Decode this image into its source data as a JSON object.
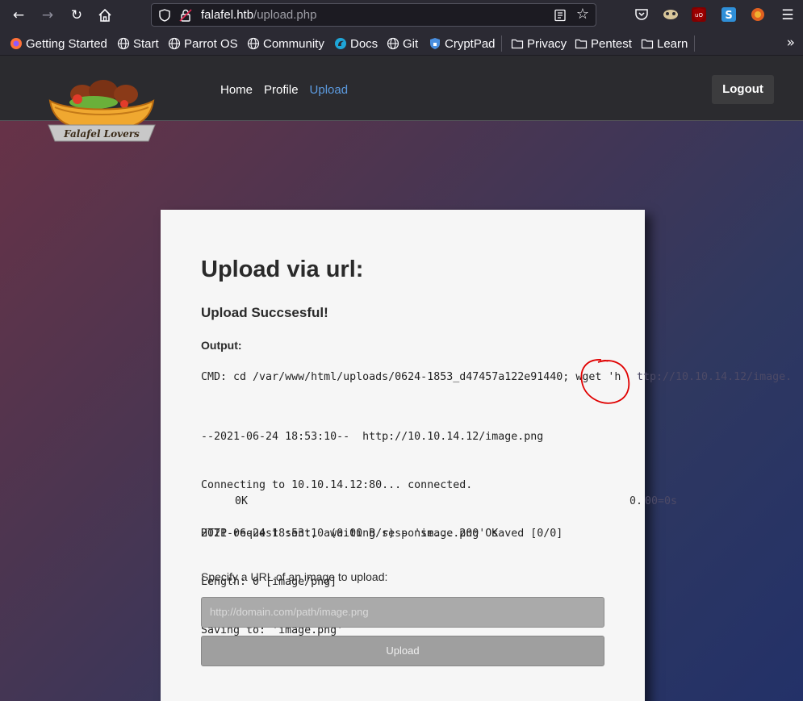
{
  "browser": {
    "url_host": "falafel.htb",
    "url_path": "/upload.php",
    "bookmarks": [
      "Getting Started",
      "Start",
      "Parrot OS",
      "Community",
      "Docs",
      "Git",
      "CryptPad",
      "Privacy",
      "Pentest",
      "Learn"
    ],
    "overflow_label": "»"
  },
  "site": {
    "logo_text": "Falafel Lovers",
    "nav": [
      "Home",
      "Profile",
      "Upload"
    ],
    "logout": "Logout"
  },
  "upload": {
    "title": "Upload via url:",
    "success": "Upload Succsesful!",
    "output_label": "Output:",
    "cmd_line": "CMD: cd /var/www/html/uploads/0624-1853_d47457a122e91440; wget 'h",
    "cmd_overflow": "ttp://10.10.14.12/image.",
    "log_lines": [
      "--2021-06-24 18:53:10--  http://10.10.14.12/image.png",
      "Connecting to 10.10.14.12:80... connected.",
      "HTTP request sent, awaiting response... 200 OK",
      "Length: 0 [image/png]",
      "Saving to: 'image.png'"
    ],
    "progress_left": "0K",
    "progress_speed_inside": "0.",
    "progress_speed_overflow": "00=0s",
    "saved_line": "2021-06-24 18:53:10 (0.00 B/s) - 'image.png' saved [0/0]",
    "spec_label": "Specify a URL of an image to upload:",
    "input_placeholder": "http://domain.com/path/image.png",
    "upload_button": "Upload"
  }
}
